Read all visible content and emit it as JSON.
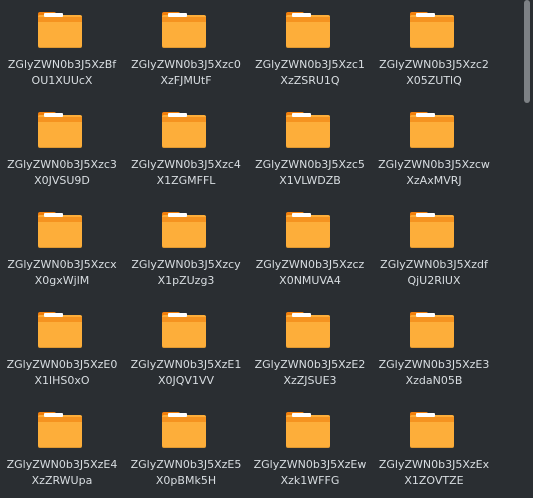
{
  "files": [
    {
      "line1": "ZGlyZWN0b3J5XzBf",
      "line2": "OU1XUUcX"
    },
    {
      "line1": "ZGlyZWN0b3J5Xzc0",
      "line2": "XzFJMUtF"
    },
    {
      "line1": "ZGlyZWN0b3J5Xzc1",
      "line2": "XzZSRU1Q"
    },
    {
      "line1": "ZGlyZWN0b3J5Xzc2",
      "line2": "X05ZUTlQ"
    },
    {
      "line1": "ZGlyZWN0b3J5Xzc3",
      "line2": "X0JVSU9D"
    },
    {
      "line1": "ZGlyZWN0b3J5Xzc4",
      "line2": "X1ZGMFFL"
    },
    {
      "line1": "ZGlyZWN0b3J5Xzc5",
      "line2": "X1VLWDZB"
    },
    {
      "line1": "ZGlyZWN0b3J5Xzcw",
      "line2": "XzAxMVRJ"
    },
    {
      "line1": "ZGlyZWN0b3J5Xzcx",
      "line2": "X0gxWjlM"
    },
    {
      "line1": "ZGlyZWN0b3J5Xzcy",
      "line2": "X1pZUzg3"
    },
    {
      "line1": "ZGlyZWN0b3J5Xzcz",
      "line2": "X0NMUVA4"
    },
    {
      "line1": "ZGlyZWN0b3J5Xzdf",
      "line2": "QjU2RlUX"
    },
    {
      "line1": "ZGlyZWN0b3J5XzE0",
      "line2": "X1lHS0xO"
    },
    {
      "line1": "ZGlyZWN0b3J5XzE1",
      "line2": "X0JQV1VV"
    },
    {
      "line1": "ZGlyZWN0b3J5XzE2",
      "line2": "XzZJSUE3"
    },
    {
      "line1": "ZGlyZWN0b3J5XzE3",
      "line2": "XzdaN05B"
    },
    {
      "line1": "ZGlyZWN0b3J5XzE4",
      "line2": "XzZRWUpa"
    },
    {
      "line1": "ZGlyZWN0b3J5XzE5",
      "line2": "X0pBMk5H"
    },
    {
      "line1": "ZGlyZWN0b3J5XzEw",
      "line2": "Xzk1WFFG"
    },
    {
      "line1": "ZGlyZWN0b3J5XzEx",
      "line2": "X1ZOVTZE"
    }
  ],
  "colors": {
    "background": "#2a2e32",
    "folder": "#fdae3a",
    "folder_dark": "#f07e0b",
    "text": "#d8dde1",
    "scroll_thumb": "#7d8185"
  },
  "icons": {
    "item": "folder-icon"
  }
}
